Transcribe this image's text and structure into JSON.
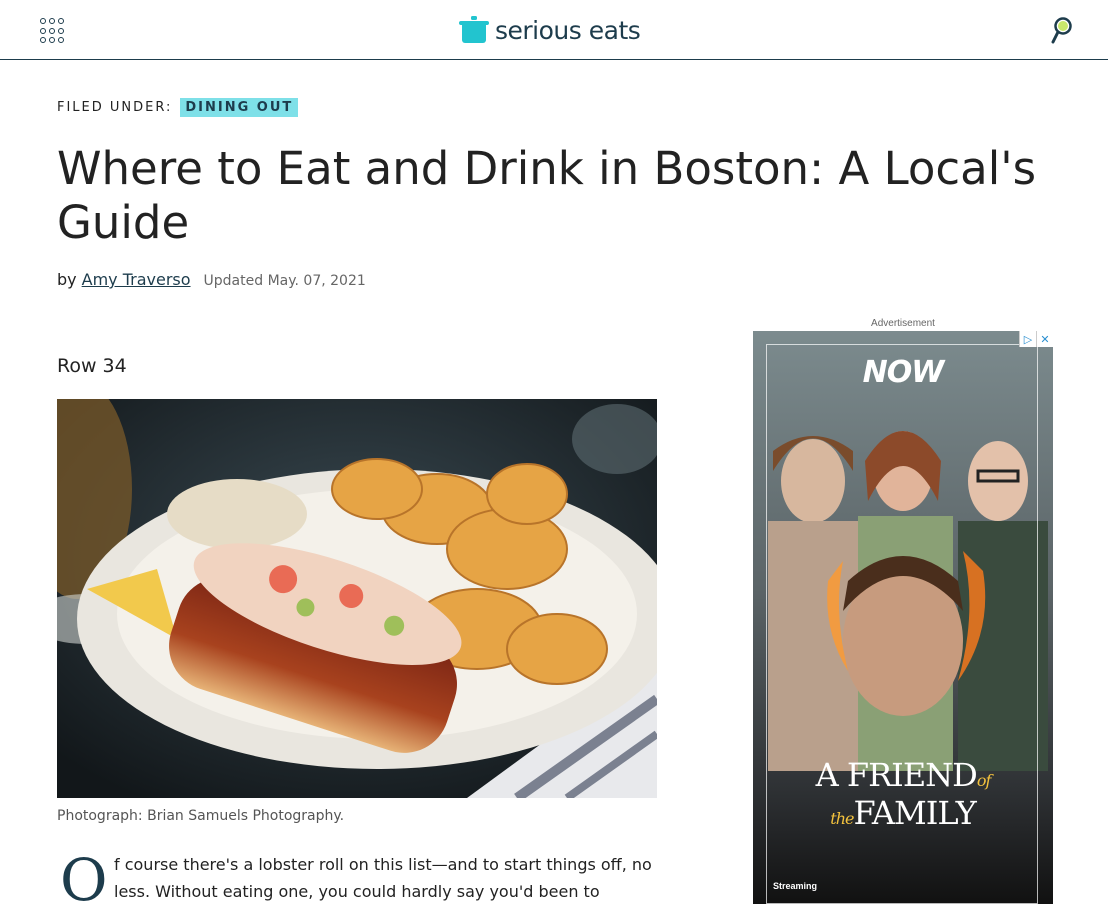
{
  "header": {
    "logo_text": "serious eats",
    "brand_color": "#1d3c4c",
    "accent_color": "#22c4cf",
    "menu_icon": "grid-menu-icon",
    "search_icon": "search-icon"
  },
  "article": {
    "filed_label": "FILED UNDER:",
    "category": "DINING OUT",
    "title": "Where to Eat and Drink in Boston: A Local's Guide",
    "by": "by",
    "author": "Amy Traverso",
    "updated": "Updated May. 07, 2021",
    "section_title": "Row 34",
    "photo_caption": "Photograph: Brian Samuels Photography.",
    "drop_cap": "O",
    "body": "f course there's a lobster roll on this list—and to start things off, no less. Without eating one, you could hardly say you'd been to"
  },
  "ad": {
    "label": "Advertisement",
    "brand": "NOW",
    "film_title_a": "A FRIEND",
    "film_title_of": "of the",
    "film_title_b": "FAMILY",
    "streaming": "Streaming",
    "adchoices_icon": "adchoices-icon",
    "close_icon": "close-icon"
  }
}
